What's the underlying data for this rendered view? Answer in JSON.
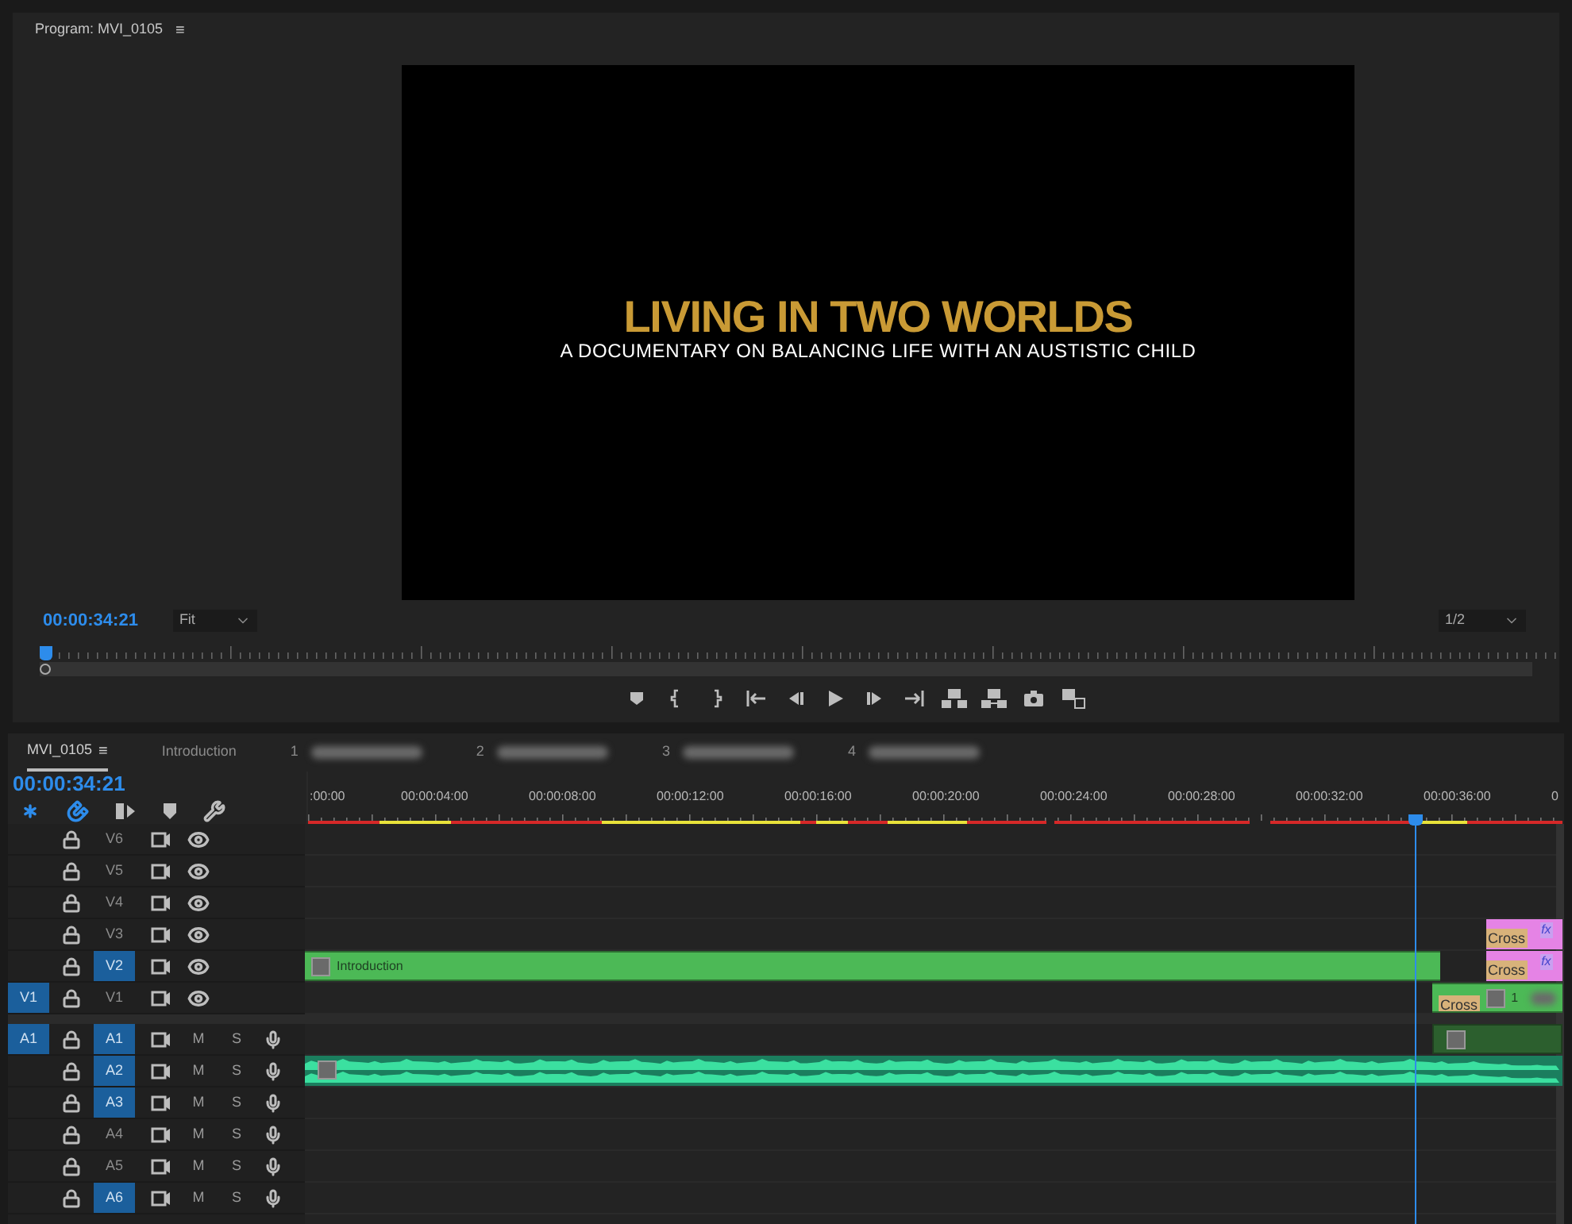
{
  "program_monitor": {
    "title": "Program: MVI_0105",
    "menu_glyph": "≡",
    "video_frame": {
      "title": "LIVING IN TWO WORLDS",
      "subtitle": "A DOCUMENTARY ON BALANCING LIFE WITH AN AUSTISTIC CHILD"
    },
    "timecode": "00:00:34:21",
    "zoom_select": "Fit",
    "resolution_select": "1/2",
    "scrubber": {
      "level": 0
    },
    "transport_buttons": [
      {
        "kind": "marker"
      },
      {
        "kind": "mark-in"
      },
      {
        "kind": "mark-out"
      },
      {
        "kind": "go-to-in"
      },
      {
        "kind": "step-back"
      },
      {
        "kind": "play"
      },
      {
        "kind": "step-forward"
      },
      {
        "kind": "go-to-out"
      },
      {
        "kind": "lift"
      },
      {
        "kind": "extract"
      },
      {
        "kind": "export-frame"
      },
      {
        "kind": "compare"
      }
    ]
  },
  "timeline": {
    "tabs": [
      {
        "label": "MVI_0105",
        "menu_glyph": "≡",
        "selected": true,
        "redacted": false
      },
      {
        "label": "Introduction",
        "selected": false,
        "redacted": false
      },
      {
        "label": "1",
        "selected": false,
        "redacted": true
      },
      {
        "label": "2",
        "selected": false,
        "redacted": true
      },
      {
        "label": "3",
        "selected": false,
        "redacted": true
      },
      {
        "label": "4",
        "selected": false,
        "redacted": true
      }
    ],
    "timecode": "00:00:34:21",
    "tools": [
      {
        "kind": "snap",
        "on": true
      },
      {
        "kind": "linked",
        "on": true
      },
      {
        "kind": "insert",
        "on": false
      },
      {
        "kind": "marker",
        "on": false
      },
      {
        "kind": "settings",
        "on": false
      }
    ],
    "ruler_labels": [
      ":00:00",
      "00:00:04:00",
      "00:00:08:00",
      "00:00:12:00",
      "00:00:16:00",
      "00:00:20:00",
      "00:00:24:00",
      "00:00:28:00",
      "00:00:32:00",
      "00:00:36:00",
      "0"
    ],
    "video_tracks": [
      {
        "name": "V6",
        "targeted": false
      },
      {
        "name": "V5",
        "targeted": false
      },
      {
        "name": "V4",
        "targeted": false
      },
      {
        "name": "V3",
        "targeted": false,
        "clips": [
          {
            "kind": "adjustment",
            "transition": "Cross",
            "badge": "fx"
          }
        ]
      },
      {
        "name": "V2",
        "targeted": true,
        "clips": [
          {
            "kind": "video",
            "label": "Introduction"
          },
          {
            "kind": "adjustment",
            "transition": "Cross",
            "badge": "fx"
          }
        ]
      },
      {
        "name": "V1",
        "targeted": false,
        "source": "V1",
        "clips": [
          {
            "kind": "video",
            "label": "1",
            "transition": "Cross",
            "redacted": true
          }
        ]
      }
    ],
    "audio_tracks": [
      {
        "name": "A1",
        "targeted": true,
        "source": "A1",
        "mute": "M",
        "solo": "S",
        "clips": [
          {
            "kind": "audio-empty"
          }
        ]
      },
      {
        "name": "A2",
        "targeted": true,
        "mute": "M",
        "solo": "S",
        "clips": [
          {
            "kind": "audio"
          }
        ]
      },
      {
        "name": "A3",
        "targeted": true,
        "mute": "M",
        "solo": "S"
      },
      {
        "name": "A4",
        "targeted": false,
        "mute": "M",
        "solo": "S"
      },
      {
        "name": "A5",
        "targeted": false,
        "mute": "M",
        "solo": "S"
      },
      {
        "name": "A6",
        "targeted": true,
        "mute": "M",
        "solo": "S"
      }
    ]
  }
}
